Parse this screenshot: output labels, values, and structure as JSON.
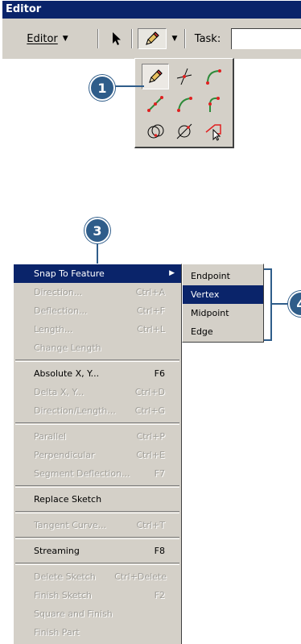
{
  "toolbar": {
    "title": "Editor",
    "editor_menu_label": "Editor",
    "task_label": "Task:"
  },
  "palette": {
    "tools": [
      "sketch-tool-icon",
      "intersection-tool-icon",
      "arc-tool-icon",
      "midpoint-tool-icon",
      "end-point-arc-tool-icon",
      "tangent-tool-icon",
      "distance-distance-tool-icon",
      "direction-distance-tool-icon",
      "trace-tool-icon"
    ]
  },
  "callouts": {
    "step1": "1",
    "step3": "3",
    "step4": "4"
  },
  "menu": {
    "items": [
      {
        "label": "Snap To Feature",
        "shortcut": "",
        "enabled": true,
        "highlight": true,
        "submenu": true
      },
      {
        "label": "Direction...",
        "shortcut": "Ctrl+A",
        "enabled": false
      },
      {
        "label": "Deflection...",
        "shortcut": "Ctrl+F",
        "enabled": false
      },
      {
        "label": "Length...",
        "shortcut": "Ctrl+L",
        "enabled": false
      },
      {
        "label": "Change Length",
        "shortcut": "",
        "enabled": false
      },
      {
        "label": "Absolute X, Y...",
        "shortcut": "F6",
        "enabled": true
      },
      {
        "label": "Delta X, Y...",
        "shortcut": "Ctrl+D",
        "enabled": false
      },
      {
        "label": "Direction/Length...",
        "shortcut": "Ctrl+G",
        "enabled": false
      },
      {
        "label": "Parallel",
        "shortcut": "Ctrl+P",
        "enabled": false
      },
      {
        "label": "Perpendicular",
        "shortcut": "Ctrl+E",
        "enabled": false
      },
      {
        "label": "Segment Deflection...",
        "shortcut": "F7",
        "enabled": false
      },
      {
        "label": "Replace Sketch",
        "shortcut": "",
        "enabled": true
      },
      {
        "label": "Tangent Curve...",
        "shortcut": "Ctrl+T",
        "enabled": false
      },
      {
        "label": "Streaming",
        "shortcut": "F8",
        "enabled": true
      },
      {
        "label": "Delete Sketch",
        "shortcut": "Ctrl+Delete",
        "enabled": false
      },
      {
        "label": "Finish Sketch",
        "shortcut": "F2",
        "enabled": false
      },
      {
        "label": "Square and Finish",
        "shortcut": "",
        "enabled": false
      },
      {
        "label": "Finish Part",
        "shortcut": "",
        "enabled": false
      }
    ]
  },
  "submenu": {
    "items": [
      {
        "label": "Endpoint",
        "highlight": false
      },
      {
        "label": "Vertex",
        "highlight": true
      },
      {
        "label": "Midpoint",
        "highlight": false
      },
      {
        "label": "Edge",
        "highlight": false
      }
    ]
  },
  "colors": {
    "highlight": "#0a246a",
    "callout": "#2f5d8a",
    "vertex": "#e02020",
    "line": "#2e8b3a"
  }
}
